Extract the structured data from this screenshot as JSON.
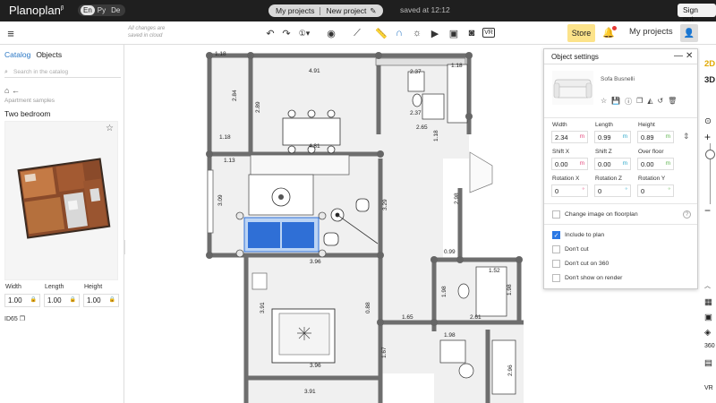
{
  "app": {
    "logo": "Planoplan",
    "logo_sup": "β"
  },
  "langs": [
    "En",
    "Ру",
    "De"
  ],
  "project": {
    "my_projects": "My projects",
    "new_project": "New project",
    "saved": "saved at 12:12"
  },
  "signout": "Sign out",
  "toolbar": {
    "hint_line1": "All changes are",
    "hint_line2": "saved in cloud",
    "store": "Store",
    "my_projects": "My projects",
    "accent": "#fce38a"
  },
  "left": {
    "tabs": [
      "Catalog",
      "Objects"
    ],
    "search_placeholder": "Search in the catalog",
    "breadcrumb_sub": "Apartment samples",
    "plan_title": "Two bedroom",
    "dims": [
      {
        "label": "Width",
        "value": "1.00"
      },
      {
        "label": "Length",
        "value": "1.00"
      },
      {
        "label": "Height",
        "value": "1.00"
      }
    ],
    "id": "ID65"
  },
  "plan": {
    "labels": [
      "1.18",
      "4.91",
      "1.18",
      "2.84",
      "2.89",
      "2.37",
      "2.37",
      "4.81",
      "1.18",
      "2.65",
      "1.13",
      "3.09",
      "3.29",
      "0.99",
      "3.96",
      "1.52",
      "1.98",
      "2.61",
      "1.65",
      "1.18",
      "3.91",
      "2.98",
      "3.91",
      "0.88",
      "1.67",
      "3.96",
      "1.98",
      "2.96",
      "1.98"
    ]
  },
  "panel": {
    "title": "Object settings",
    "product": "Sofa Busnelli",
    "fields": [
      {
        "label": "Width",
        "value": "2.34",
        "unit": "m"
      },
      {
        "label": "Length",
        "value": "0.99",
        "unit": "m"
      },
      {
        "label": "Height",
        "value": "0.89",
        "unit": "m"
      },
      {
        "label": "Shift X",
        "value": "0.00",
        "unit": "m"
      },
      {
        "label": "Shift Z",
        "value": "0.00",
        "unit": "m"
      },
      {
        "label": "Over floor",
        "value": "0.00",
        "unit": "m"
      },
      {
        "label": "Rotation X",
        "value": "0",
        "unit": "°"
      },
      {
        "label": "Rotation Z",
        "value": "0",
        "unit": "°"
      },
      {
        "label": "Rotation Y",
        "value": "0",
        "unit": "°"
      }
    ],
    "change_image": "Change image on floorplan",
    "options": [
      {
        "label": "Include to plan",
        "checked": true
      },
      {
        "label": "Don't cut",
        "checked": false
      },
      {
        "label": "Don't cut on 360",
        "checked": false
      },
      {
        "label": "Don't show on render",
        "checked": false
      }
    ],
    "accent": "#2b78e4"
  },
  "rightbar": {
    "b2d": "2D",
    "b3d": "3D",
    "zoom_in": "+",
    "zoom_out": "−"
  },
  "colors": {
    "wall": "#6e6e6e",
    "floor": "#f0f0f0",
    "selection": "#2f6fd6"
  }
}
